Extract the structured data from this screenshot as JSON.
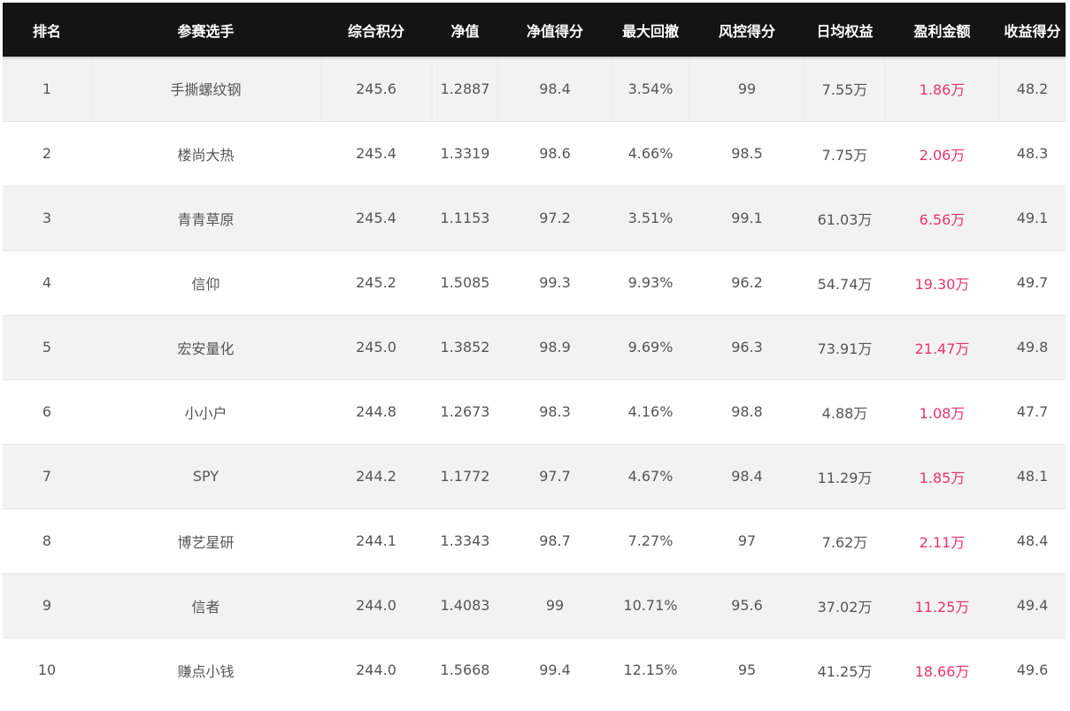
{
  "table": {
    "headers": [
      "排名",
      "参赛选手",
      "综合积分",
      "净值",
      "净值得分",
      "最大回撤",
      "风控得分",
      "日均权益",
      "盈利金额",
      "收益得分"
    ],
    "rows": [
      [
        "1",
        "手撕螺纹钢",
        "245.6",
        "1.2887",
        "98.4",
        "3.54%",
        "99",
        "7.55万",
        "1.86万",
        "48.2"
      ],
      [
        "2",
        "楼尚大热",
        "245.4",
        "1.3319",
        "98.6",
        "4.66%",
        "98.5",
        "7.75万",
        "2.06万",
        "48.3"
      ],
      [
        "3",
        "青青草原",
        "245.4",
        "1.1153",
        "97.2",
        "3.51%",
        "99.1",
        "61.03万",
        "6.56万",
        "49.1"
      ],
      [
        "4",
        "信仰",
        "245.2",
        "1.5085",
        "99.3",
        "9.93%",
        "96.2",
        "54.74万",
        "19.30万",
        "49.7"
      ],
      [
        "5",
        "宏安量化",
        "245.0",
        "1.3852",
        "98.9",
        "9.69%",
        "96.3",
        "73.91万",
        "21.47万",
        "49.8"
      ],
      [
        "6",
        "小小户",
        "244.8",
        "1.2673",
        "98.3",
        "4.16%",
        "98.8",
        "4.88万",
        "1.08万",
        "47.7"
      ],
      [
        "7",
        "SPY",
        "244.2",
        "1.1772",
        "97.7",
        "4.67%",
        "98.4",
        "11.29万",
        "1.85万",
        "48.1"
      ],
      [
        "8",
        "博艺星研",
        "244.1",
        "1.3343",
        "98.7",
        "7.27%",
        "97",
        "7.62万",
        "2.11万",
        "48.4"
      ],
      [
        "9",
        "信者",
        "244.0",
        "1.4083",
        "99",
        "10.71%",
        "95.6",
        "37.02万",
        "11.25万",
        "49.4"
      ],
      [
        "10",
        "赚点小钱",
        "244.0",
        "1.5668",
        "99.4",
        "12.15%",
        "95",
        "41.25万",
        "18.66万",
        "49.6"
      ]
    ]
  },
  "colors": {
    "header_bg": "#141414",
    "header_text": "#ffffff",
    "row_odd": "#f2f2f2",
    "row_even": "#ffffff",
    "cell_text": "#555555",
    "profit_text": "#e7336f"
  }
}
